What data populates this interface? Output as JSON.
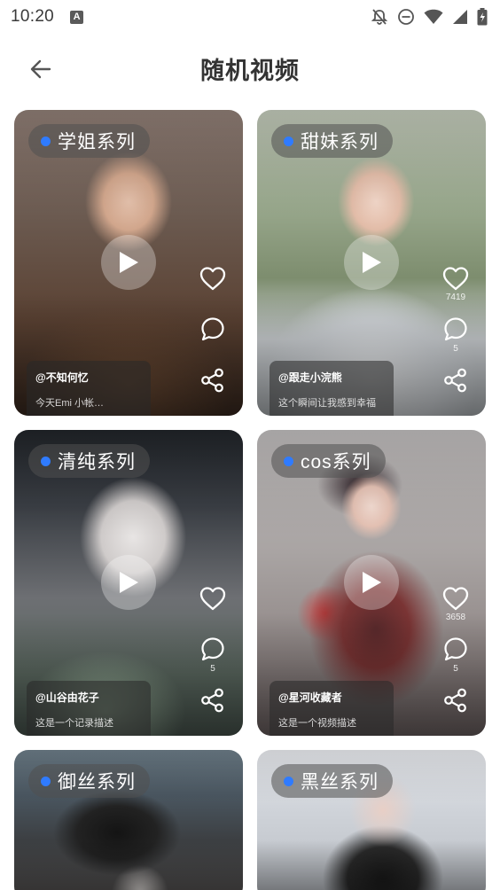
{
  "status_bar": {
    "time": "10:20",
    "badge": "A"
  },
  "header": {
    "title": "随机视频"
  },
  "cards": [
    {
      "tag": "学姐系列",
      "likes": "",
      "comments": "",
      "author": "@不知何忆",
      "desc": "今天Emi 小帐…"
    },
    {
      "tag": "甜妹系列",
      "likes": "7419",
      "comments": "5",
      "author": "@跟走小浣熊",
      "desc": "这个瞬间让我感到幸福"
    },
    {
      "tag": "清纯系列",
      "likes": "",
      "comments": "5",
      "author": "@山谷由花子",
      "desc": "这是一个记录描述"
    },
    {
      "tag": "cos系列",
      "likes": "3658",
      "comments": "5",
      "author": "@星河收藏者",
      "desc": "这是一个视频描述"
    },
    {
      "tag": "御丝系列"
    },
    {
      "tag": "黑丝系列"
    }
  ]
}
